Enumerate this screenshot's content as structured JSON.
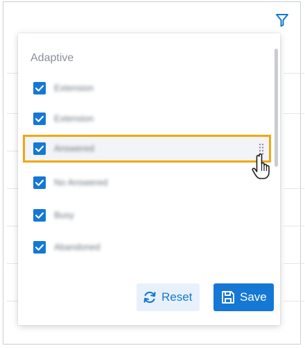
{
  "toolbar": {
    "filter_icon": "filter-icon"
  },
  "columns_panel": {
    "section_title": "Adaptive",
    "items": [
      {
        "label": "Extension",
        "checked": true
      },
      {
        "label": "Extension",
        "checked": true
      },
      {
        "label": "Answered",
        "checked": true,
        "highlighted": true,
        "drag_handle_icon": "drag-handle-icon"
      },
      {
        "label": "No Answered",
        "checked": true
      },
      {
        "label": "Busy",
        "checked": true
      },
      {
        "label": "Abandoned",
        "checked": true
      }
    ],
    "reset_label": "Reset",
    "save_label": "Save"
  },
  "colors": {
    "accent": "#1478d4",
    "highlight": "#f2a70e",
    "reset_bg": "#e8f1fb"
  },
  "icons": {
    "reset": "refresh-icon",
    "save": "save-icon",
    "cursor": "hand-cursor-icon"
  }
}
